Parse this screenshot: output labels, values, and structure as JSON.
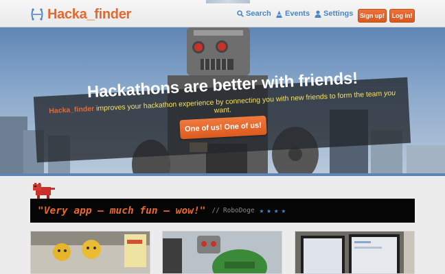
{
  "header": {
    "logo_text": "Hacka_finder",
    "nav": {
      "search": "Search",
      "events": "Events",
      "settings": "Settings"
    },
    "buttons": {
      "signup": "Sign up!",
      "login": "Log in!"
    }
  },
  "hero": {
    "title": "Hackathons are better with friends!",
    "subtitle_brand": "Hacka_finder",
    "subtitle_pre": " improves your hackathon experience by connecting you with new friends to form the team ",
    "subtitle_em": "you",
    "subtitle_post": " want.",
    "cta_label": "One of us! One of us!"
  },
  "testimonial": {
    "quote": "\"Very app — much fun — wow!\"",
    "separator": "//",
    "author": "RoboDoge",
    "stars": "★★★★",
    "rating": 4
  },
  "colors": {
    "brand_orange": "#e4692f",
    "link_blue": "#4a86c8",
    "quote_bg": "#050505",
    "subtitle_yellow": "#f4e15a"
  },
  "icons": {
    "logo": "hacka-logo-icon",
    "search": "search-icon",
    "events": "events-icon",
    "settings": "user-icon",
    "mascot": "robot-dog-icon"
  }
}
